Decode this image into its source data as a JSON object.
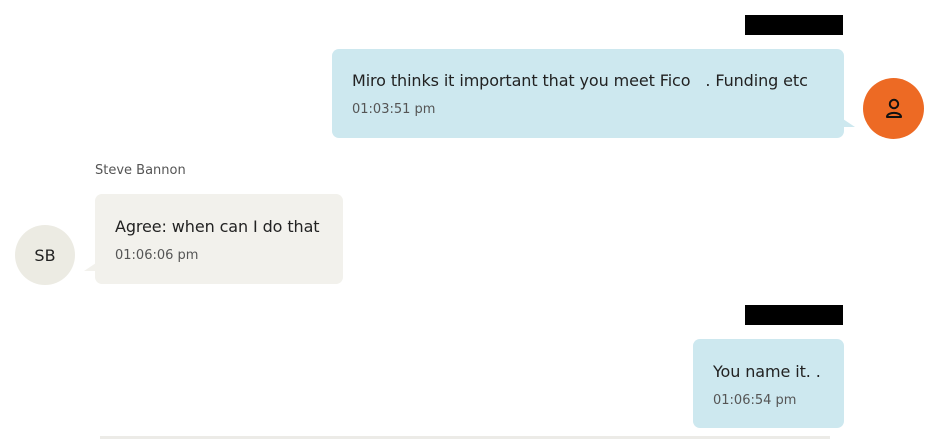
{
  "messages": [
    {
      "direction": "outgoing",
      "text": "Miro thinks it important that you meet Fico   . Funding etc",
      "time": "01:03:51 pm",
      "avatar_icon": "user-icon",
      "redacted_header": true
    },
    {
      "direction": "incoming",
      "sender": "Steve Bannon",
      "avatar_initials": "SB",
      "text": "Agree: when can I do that",
      "time": "01:06:06 pm"
    },
    {
      "direction": "outgoing",
      "text": "You name it. .",
      "time": "01:06:54 pm",
      "redacted_header": true
    }
  ],
  "colors": {
    "outgoing_bubble": "#cde8ef",
    "incoming_bubble": "#f2f1ec",
    "user_avatar": "#ed6a24",
    "initials_avatar": "#ecebe3",
    "redaction": "#000000"
  }
}
